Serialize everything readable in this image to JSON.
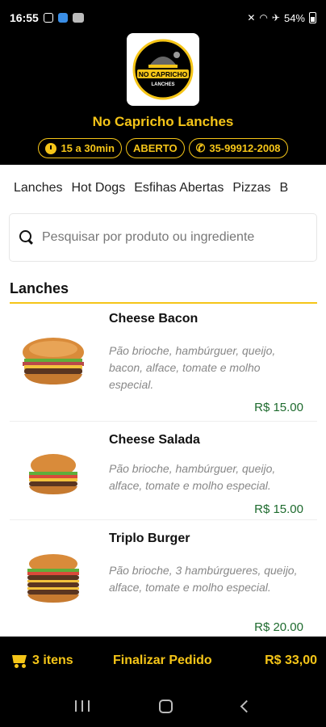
{
  "status_bar": {
    "time": "16:55",
    "battery": "54%"
  },
  "store": {
    "name": "No Capricho Lanches",
    "logo_text_main": "NO CAPRICHO",
    "logo_text_sub": "LANCHES",
    "delivery_time": "15 a 30min",
    "status": "ABERTO",
    "phone": "35-99912-2008"
  },
  "categories": [
    "Lanches",
    "Hot Dogs",
    "Esfihas Abertas",
    "Pizzas",
    "B"
  ],
  "search": {
    "placeholder": "Pesquisar por produto ou ingrediente"
  },
  "section": {
    "title": "Lanches"
  },
  "products": [
    {
      "name": "Cheese Bacon",
      "description": "Pão brioche, hambúrguer, queijo, bacon, alface, tomate e molho especial.",
      "price": "R$ 15.00"
    },
    {
      "name": "Cheese Salada",
      "description": "Pão brioche, hambúrguer, queijo, alface, tomate e molho especial.",
      "price": "R$ 15.00"
    },
    {
      "name": "Triplo Burger",
      "description": "Pão brioche, 3 hambúrgueres, queijo, alface, tomate e molho especial.",
      "price": "R$ 20.00"
    }
  ],
  "cart": {
    "items_label": "3 itens",
    "checkout_label": "Finalizar Pedido",
    "total": "R$ 33,00"
  },
  "colors": {
    "accent": "#f5c518",
    "price": "#1e6b2e",
    "background_dark": "#000000"
  }
}
